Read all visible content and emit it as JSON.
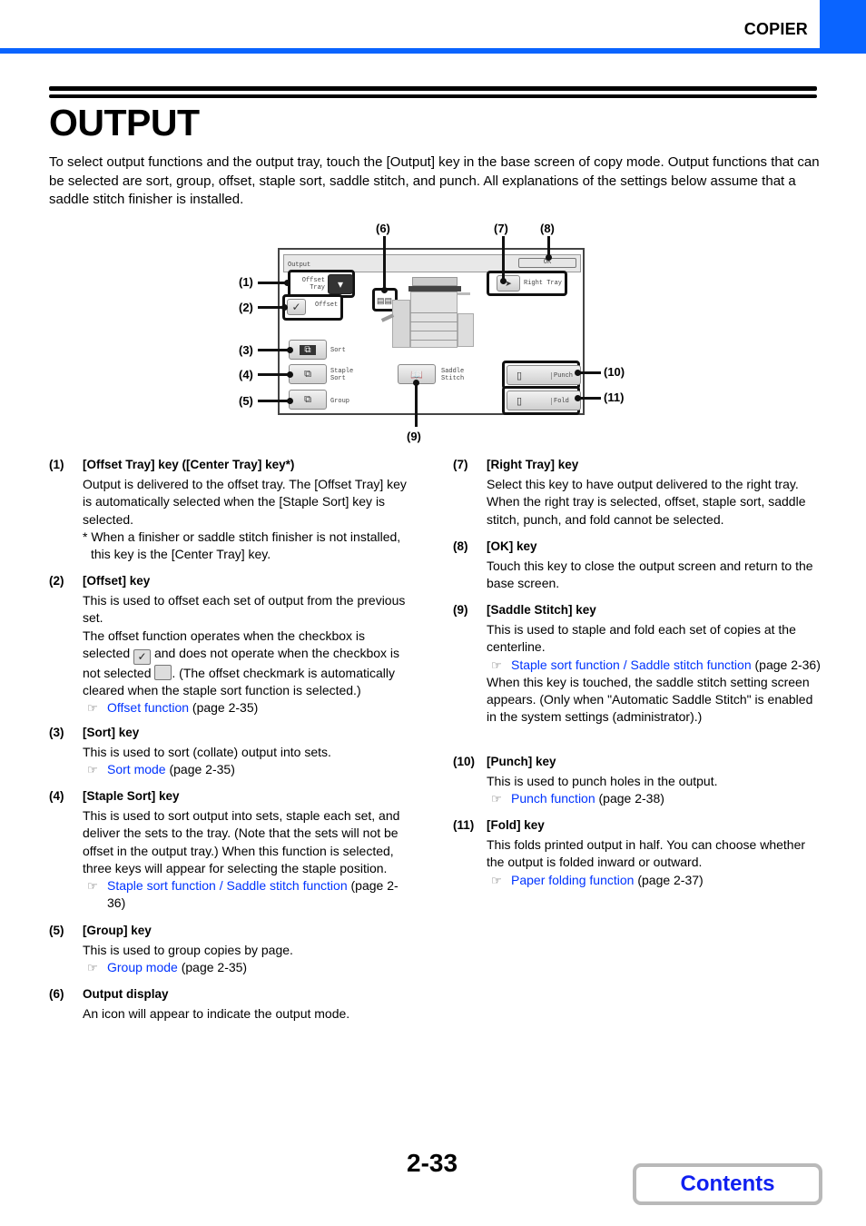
{
  "header": {
    "section_label": "COPIER",
    "accent_color": "#0a64ff"
  },
  "title": "OUTPUT",
  "intro": "To select output functions and the output tray, touch the [Output] key in the base screen of copy mode. Output functions that can be selected are sort, group, offset, staple sort, saddle stitch, and punch. All explanations of the settings below assume that a saddle stitch finisher is installed.",
  "screen": {
    "title": "Output",
    "ok_label": "OK",
    "offset_tray_label_1": "Offset",
    "offset_tray_label_2": "Tray",
    "offset_label": "Offset",
    "right_tray_label": "Right Tray",
    "sort_label": "Sort",
    "staple_sort_label_1": "Staple",
    "staple_sort_label_2": "Sort",
    "group_label": "Group",
    "saddle_stitch_label_1": "Saddle",
    "saddle_stitch_label_2": "Stitch",
    "punch_label": "Punch",
    "fold_label": "Fold",
    "offset_checked": true,
    "callouts": {
      "c1": "(1)",
      "c2": "(2)",
      "c3": "(3)",
      "c4": "(4)",
      "c5": "(5)",
      "c6": "(6)",
      "c7": "(7)",
      "c8": "(8)",
      "c9": "(9)",
      "c10": "(10)",
      "c11": "(11)"
    }
  },
  "items": {
    "i1": {
      "num": "(1)",
      "head": "[Offset Tray] key ([Center Tray] key*)",
      "body": "Output is delivered to the offset tray. The [Offset Tray] key is automatically selected when the [Staple Sort] key is selected.",
      "note": "* When a finisher or saddle stitch finisher is not installed, this key is the [Center Tray] key."
    },
    "i2": {
      "num": "(2)",
      "head": "[Offset] key",
      "body1": "This is used to offset each set of output from the previous set.",
      "body2a": "The offset function operates when the checkbox is selected",
      "body2b": "and does not operate when the checkbox is not selected",
      "body2c": ". (The offset checkmark is automatically cleared when the staple sort function is selected.)",
      "ref_link": "Offset function",
      "ref_page": "(page 2-35)"
    },
    "i3": {
      "num": "(3)",
      "head": "[Sort] key",
      "body": "This is used to sort (collate) output into sets.",
      "ref_link": "Sort mode",
      "ref_page": "(page 2-35)"
    },
    "i4": {
      "num": "(4)",
      "head": "[Staple Sort] key",
      "body": "This is used to sort output into sets, staple each set, and deliver the sets to the tray. (Note that the sets will not be offset in the output tray.) When this function is selected, three keys will appear for selecting the staple position.",
      "ref_link": "Staple sort function / Saddle stitch function",
      "ref_page": "(page 2-36)"
    },
    "i5": {
      "num": "(5)",
      "head": "[Group] key",
      "body": "This is used to group copies by page.",
      "ref_link": "Group mode",
      "ref_page": "(page 2-35)"
    },
    "i6": {
      "num": "(6)",
      "head": "Output display",
      "body": "An icon will appear to indicate the output mode."
    },
    "i7": {
      "num": "(7)",
      "head": "[Right Tray] key",
      "body": "Select this key to have output delivered to the right tray. When the right tray is selected, offset, staple sort, saddle stitch, punch, and fold cannot be selected."
    },
    "i8": {
      "num": "(8)",
      "head": "[OK] key",
      "body": "Touch this key to close the output screen and return to the base screen."
    },
    "i9": {
      "num": "(9)",
      "head": "[Saddle Stitch] key",
      "body": "This is used to staple and fold each set of copies at the centerline.",
      "ref_link": "Staple sort function / Saddle stitch function",
      "ref_page": "(page 2-36)",
      "body2": "When this key is touched, the saddle stitch setting screen appears. (Only when \"Automatic Saddle Stitch\" is enabled in the system settings (administrator).)"
    },
    "i10": {
      "num": "(10)",
      "head": "[Punch] key",
      "body": "This is used to punch holes in the output.",
      "ref_link": "Punch function",
      "ref_page": "(page 2-38)"
    },
    "i11": {
      "num": "(11)",
      "head": "[Fold] key",
      "body": "This folds printed output in half. You can choose whether the output is folded inward or outward.",
      "ref_link": "Paper folding function",
      "ref_page": "(page 2-37)"
    }
  },
  "icons": {
    "ref": "☞",
    "check": "✓"
  },
  "footer": {
    "page_number": "2-33",
    "contents_label": "Contents"
  }
}
